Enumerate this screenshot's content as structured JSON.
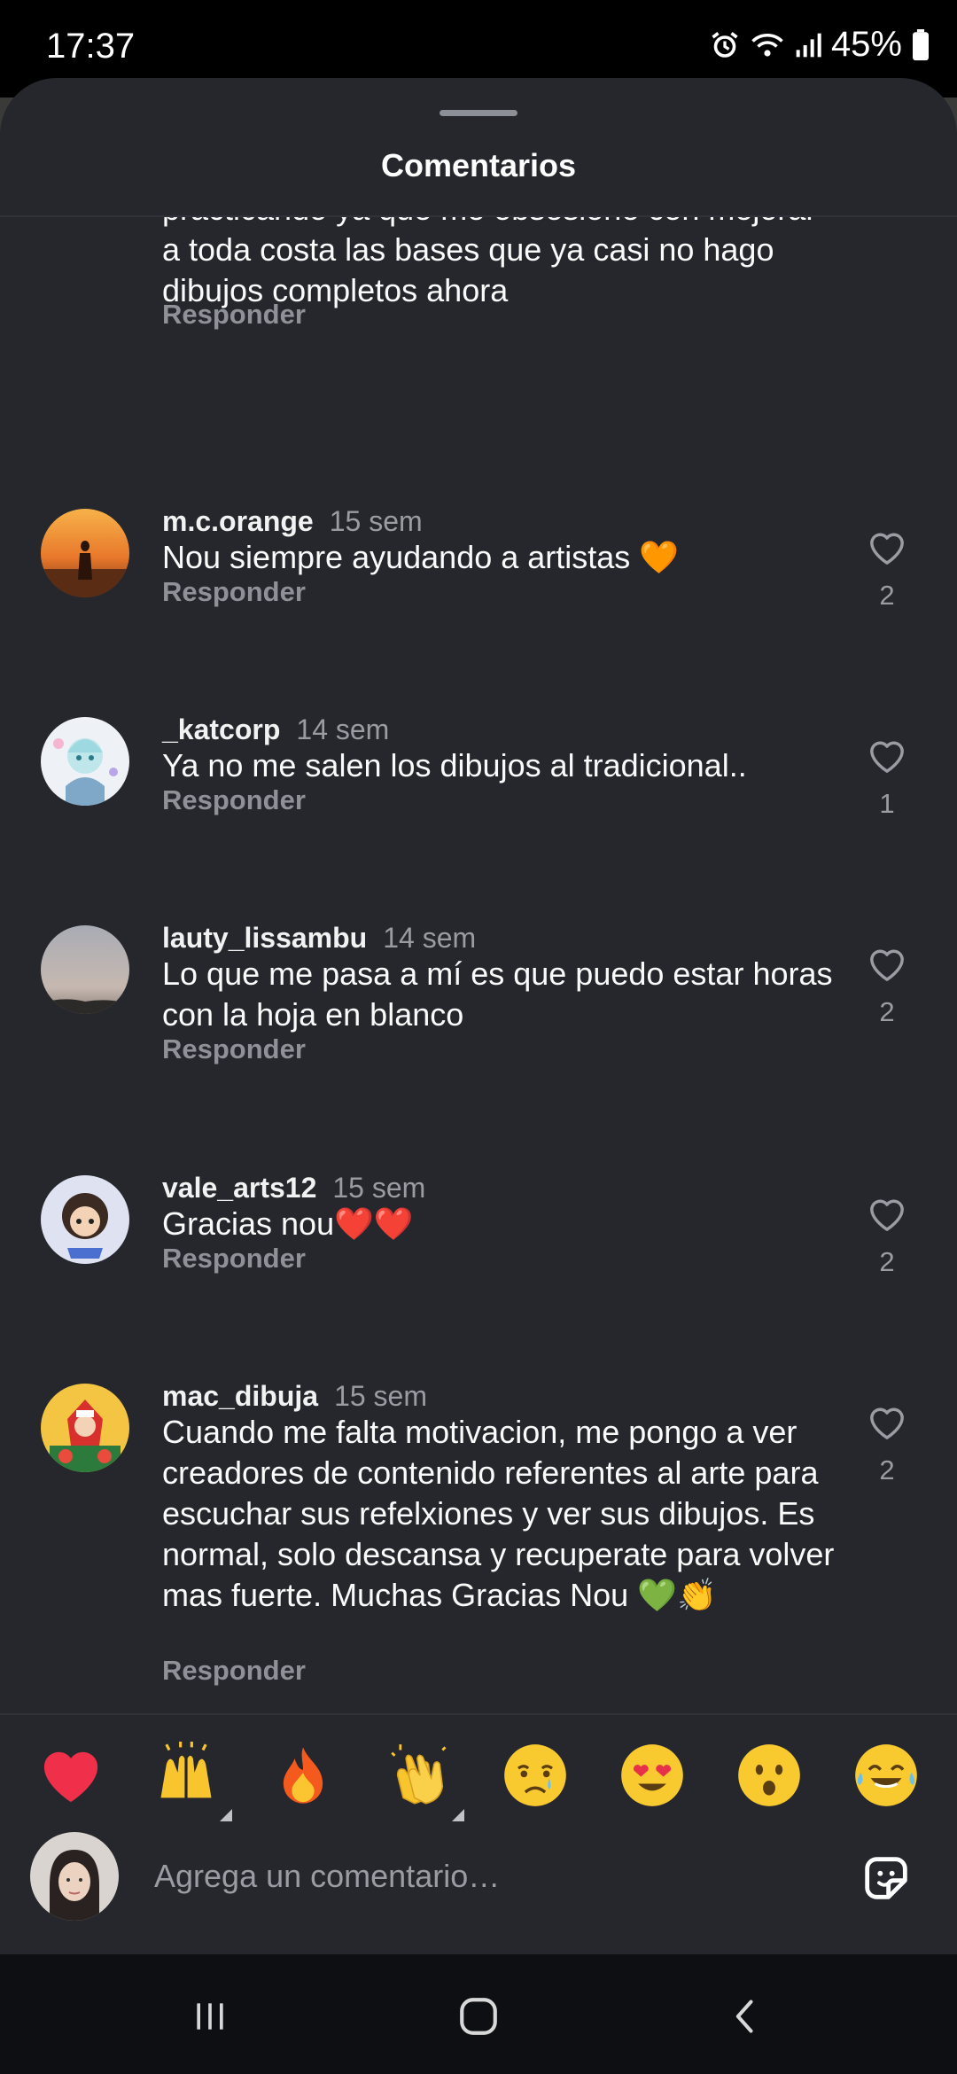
{
  "status_bar": {
    "time": "17:37",
    "battery": "45%"
  },
  "sheet": {
    "title": "Comentarios"
  },
  "comments": [
    {
      "user": "",
      "time": "",
      "text": "practicando ya que me obsesioné con mejorar a toda costa las bases que ya casi no hago dibujos completos ahora",
      "reply": "Responder",
      "likes": ""
    },
    {
      "user": "m.c.orange",
      "time": "15 sem",
      "text": "Nou siempre ayudando a artistas 🧡",
      "reply": "Responder",
      "likes": "2"
    },
    {
      "user": "_katcorp",
      "time": "14 sem",
      "text": "Ya no me salen los dibujos al tradicional..",
      "reply": "Responder",
      "likes": "1"
    },
    {
      "user": "lauty_lissambu",
      "time": "14 sem",
      "text": "Lo que me pasa a mí es que puedo estar horas con la hoja en blanco",
      "reply": "Responder",
      "likes": "2"
    },
    {
      "user": "vale_arts12",
      "time": "15 sem",
      "text": "Gracias nou❤️❤️",
      "reply": "Responder",
      "likes": "2"
    },
    {
      "user": "mac_dibuja",
      "time": "15 sem",
      "text": "Cuando me falta motivacion, me pongo a ver creadores de contenido referentes al arte para escuchar sus refelxiones y ver sus dibujos. Es normal, solo descansa y recuperate para volver mas fuerte. Muchas Gracias Nou 💚👏",
      "reply": "Responder",
      "likes": "2"
    }
  ],
  "emoji_bar": [
    {
      "icon": "red-heart-icon"
    },
    {
      "icon": "raising-hands-icon",
      "has_skin_tone": true
    },
    {
      "icon": "fire-icon"
    },
    {
      "icon": "clapping-hands-icon",
      "has_skin_tone": true
    },
    {
      "icon": "crying-face-icon"
    },
    {
      "icon": "heart-eyes-face-icon"
    },
    {
      "icon": "surprised-face-icon"
    },
    {
      "icon": "tears-of-joy-face-icon"
    }
  ],
  "composer": {
    "placeholder": "Agrega un comentario…"
  },
  "colors": {
    "sheet_bg": "#25272c",
    "text": "#fafafa",
    "muted": "#9a9ca3",
    "nav_bg": "#0e0f12"
  }
}
